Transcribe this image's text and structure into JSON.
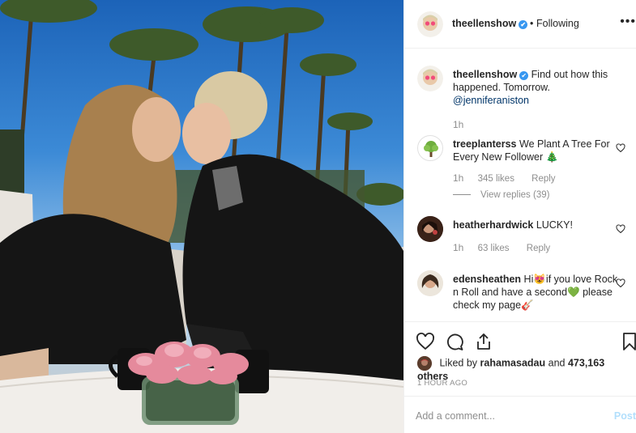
{
  "post": {
    "author": "theellenshow",
    "follow_separator": "•",
    "follow_status": "Following",
    "more_icon": "more-horizontal-icon",
    "verified_icon": "verified-badge-icon",
    "verified_glyph": "✔",
    "photo_alt": "Two people kissing on a talk show set with palm trees and flowers"
  },
  "caption": {
    "author": "theellenshow",
    "text": "Find out how this happened. Tomorrow.",
    "mention": "@jenniferaniston",
    "time": "1h"
  },
  "comments": [
    {
      "author": "treeplanterss",
      "text": "We Plant A Tree For Every New Follower 🎄",
      "time": "1h",
      "likes": "345 likes",
      "reply": "Reply",
      "view_replies": "View replies (39)"
    },
    {
      "author": "heatherhardwick",
      "text": "LUCKY!",
      "time": "1h",
      "likes": "63 likes",
      "reply": "Reply"
    },
    {
      "author": "edensheathen",
      "text": "Hi😻if you love Rock n Roll and have a second💚 please check my page🎸"
    }
  ],
  "actions": {
    "like_icon": "heart-icon",
    "comment_icon": "comment-icon",
    "share_icon": "share-icon",
    "save_icon": "bookmark-icon"
  },
  "likes": {
    "prefix": "Liked by",
    "user": "rahamasadau",
    "connector": "and",
    "count": "473,163 others"
  },
  "posted_ago": "1 HOUR AGO",
  "add_comment": {
    "placeholder": "Add a comment...",
    "post_label": "Post"
  },
  "colors": {
    "accent": "#3897f0",
    "text": "#262626",
    "muted": "#8e8e8e",
    "post_disabled": "#b2dffc",
    "border": "#efefef"
  }
}
